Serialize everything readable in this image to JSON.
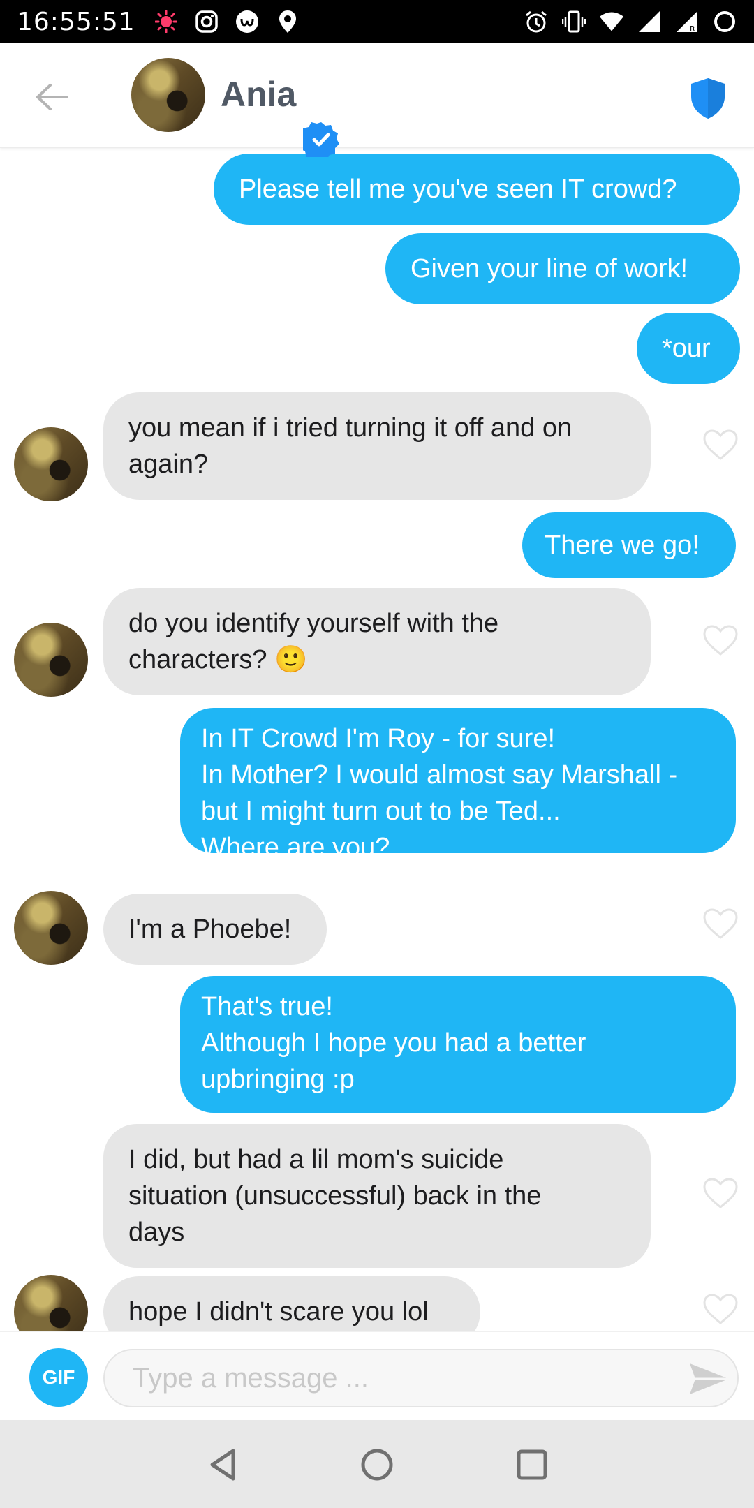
{
  "status_bar": {
    "time": "16:55:51",
    "left_icons": [
      "record-icon",
      "instagram-icon",
      "app-icon",
      "location-icon"
    ],
    "right_icons": [
      "alarm-icon",
      "vibrate-icon",
      "wifi-icon",
      "signal-icon",
      "signal-roaming-icon",
      "battery-icon"
    ]
  },
  "header": {
    "contact_name": "Ania",
    "verified": true,
    "accent_color": "#1f8ff5"
  },
  "messages": [
    {
      "id": 1,
      "direction": "outgoing",
      "text": "Please tell me you've seen IT crowd?"
    },
    {
      "id": 2,
      "direction": "outgoing",
      "text": "Given your line of work!"
    },
    {
      "id": 3,
      "direction": "outgoing",
      "text": "*our"
    },
    {
      "id": 4,
      "direction": "incoming",
      "text": "you mean if i tried turning it off and on\nagain?"
    },
    {
      "id": 5,
      "direction": "outgoing",
      "text": "There we go!"
    },
    {
      "id": 6,
      "direction": "incoming",
      "text": "do you identify yourself with the\ncharacters? 🙂"
    },
    {
      "id": 7,
      "direction": "outgoing",
      "text": "In IT Crowd I'm Roy - for sure!\nIn Mother? I would almost say Marshall -\nbut I might turn out to be Ted...\nWhere are you?"
    },
    {
      "id": 8,
      "direction": "incoming",
      "text": "I'm a Phoebe!"
    },
    {
      "id": 9,
      "direction": "outgoing",
      "text": "That's true!\nAlthough I hope you had a better\nupbringing :p"
    },
    {
      "id": 10,
      "direction": "incoming",
      "text": "I did, but had a lil mom's suicide\nsituation (unsuccessful) back in the\ndays"
    },
    {
      "id": 11,
      "direction": "incoming",
      "text": "hope I didn't scare you lol"
    }
  ],
  "composer": {
    "gif_label": "GIF",
    "placeholder": "Type a message ...",
    "value": ""
  },
  "colors": {
    "outgoing_bubble": "#1fb6f5",
    "incoming_bubble": "#e6e6e6",
    "header_name": "#505965"
  }
}
